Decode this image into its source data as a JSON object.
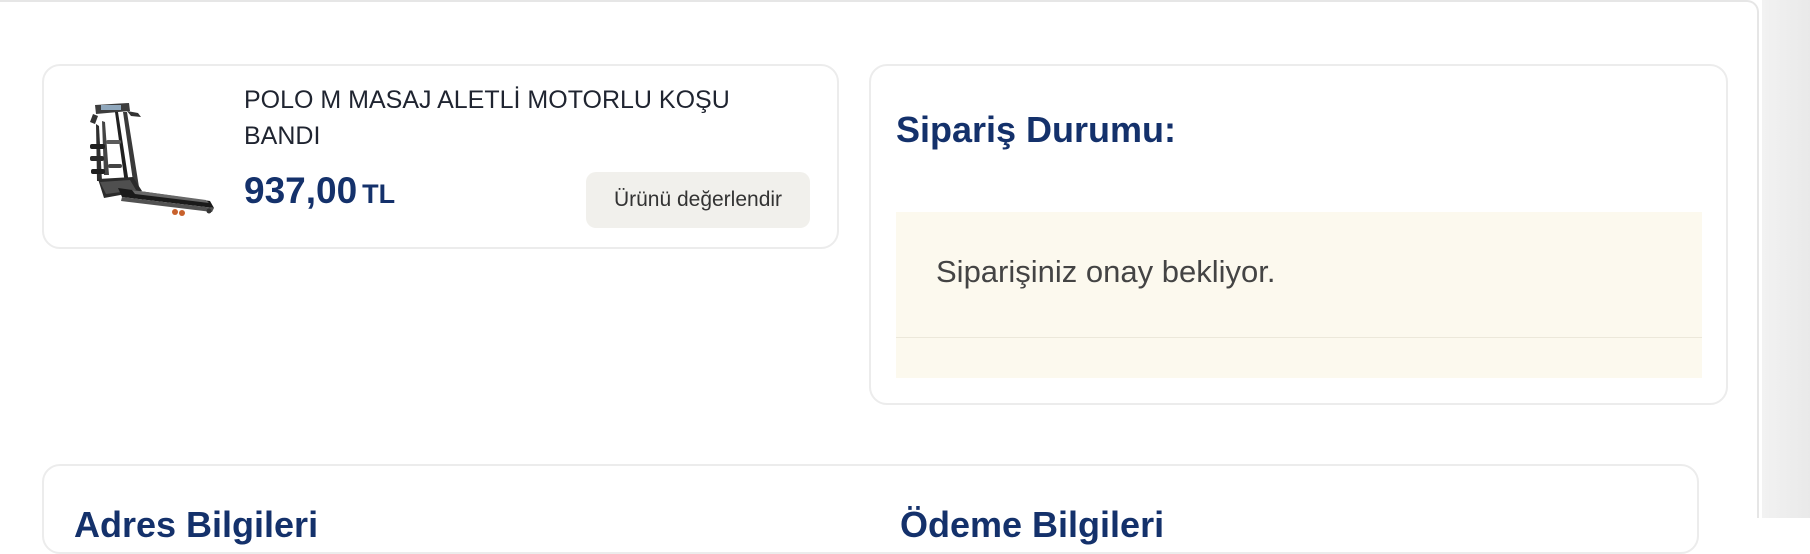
{
  "product": {
    "name": "POLO M MASAJ ALETLİ MOTORLU KOŞU BANDI",
    "price_value": "937,00",
    "price_currency": "TL",
    "review_button_label": "Ürünü değerlendir"
  },
  "order_status": {
    "title": "Sipariş Durumu:",
    "message": "Siparişiniz onay bekliyor."
  },
  "info": {
    "address_title": "Adres Bilgileri",
    "payment_title": "Ödeme Bilgileri"
  },
  "colors": {
    "brand_navy": "#14316b",
    "status_background": "#fcf9ee",
    "button_background": "#f1f0ec"
  },
  "icons": {
    "product_image": "treadmill-image"
  }
}
